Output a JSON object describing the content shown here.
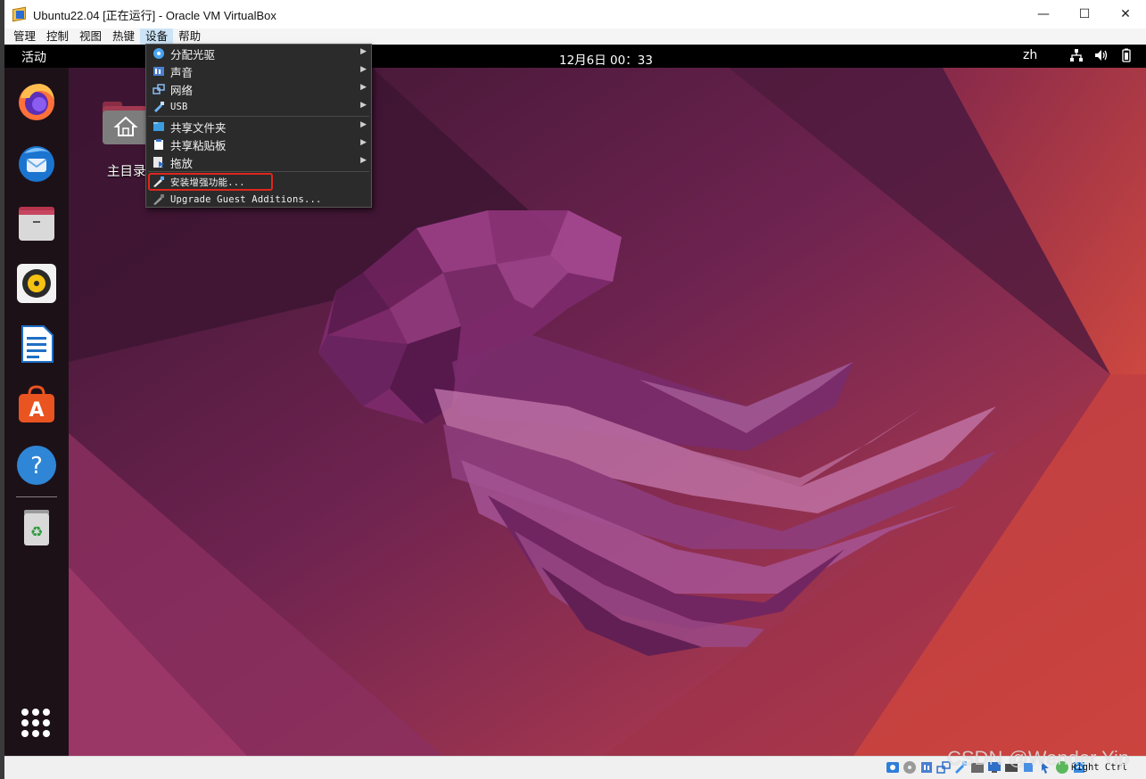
{
  "window": {
    "title": "Ubuntu22.04 [正在运行] - Oracle VM VirtualBox",
    "minimize": "—",
    "maximize": "☐",
    "close": "✕"
  },
  "menubar": {
    "items": [
      {
        "label": "管理"
      },
      {
        "label": "控制"
      },
      {
        "label": "视图"
      },
      {
        "label": "热键"
      },
      {
        "label": "设备"
      },
      {
        "label": "帮助"
      }
    ],
    "active_index": 4
  },
  "guest_topbar": {
    "activities": "活动",
    "clock": "12月6日  00：33",
    "language": "zh",
    "tray_icons": [
      "network-icon",
      "volume-icon",
      "battery-icon"
    ]
  },
  "desktop": {
    "home_folder_label": "主目录"
  },
  "dock": {
    "apps": [
      {
        "name": "firefox-icon"
      },
      {
        "name": "thunderbird-icon"
      },
      {
        "name": "files-icon"
      },
      {
        "name": "rhythmbox-icon"
      },
      {
        "name": "libreoffice-writer-icon"
      },
      {
        "name": "ubuntu-software-icon"
      },
      {
        "name": "help-icon"
      },
      {
        "name": "trash-icon"
      }
    ],
    "show_apps": "apps-grid-icon"
  },
  "devices_menu": {
    "items": [
      {
        "label": "分配光驱",
        "submenu": true,
        "icon": "optical-drive-icon"
      },
      {
        "label": "声音",
        "submenu": true,
        "icon": "audio-icon"
      },
      {
        "label": "网络",
        "submenu": true,
        "icon": "network-icon"
      },
      {
        "label": "USB",
        "submenu": true,
        "icon": "usb-icon"
      },
      {
        "label": "共享文件夹",
        "submenu": true,
        "icon": "shared-folder-icon"
      },
      {
        "label": "共享粘贴板",
        "submenu": true,
        "icon": "clipboard-icon"
      },
      {
        "label": "拖放",
        "submenu": true,
        "icon": "drag-drop-icon"
      },
      {
        "label": "安装增强功能...",
        "submenu": false,
        "icon": "guest-additions-icon"
      },
      {
        "label": "Upgrade Guest Additions...",
        "submenu": false,
        "icon": "upgrade-guest-additions-icon"
      }
    ],
    "submenu_arrow": "▶"
  },
  "statusbar": {
    "host_key": "Right Ctrl"
  },
  "watermark": "CSDN @Wender Yip",
  "colors": {
    "menu_bg": "#2b2b2b",
    "highlight_box": "#e0261e",
    "ubuntu_bg_dark": "#3b1530",
    "ubuntu_bg_orange": "#d8453a"
  }
}
